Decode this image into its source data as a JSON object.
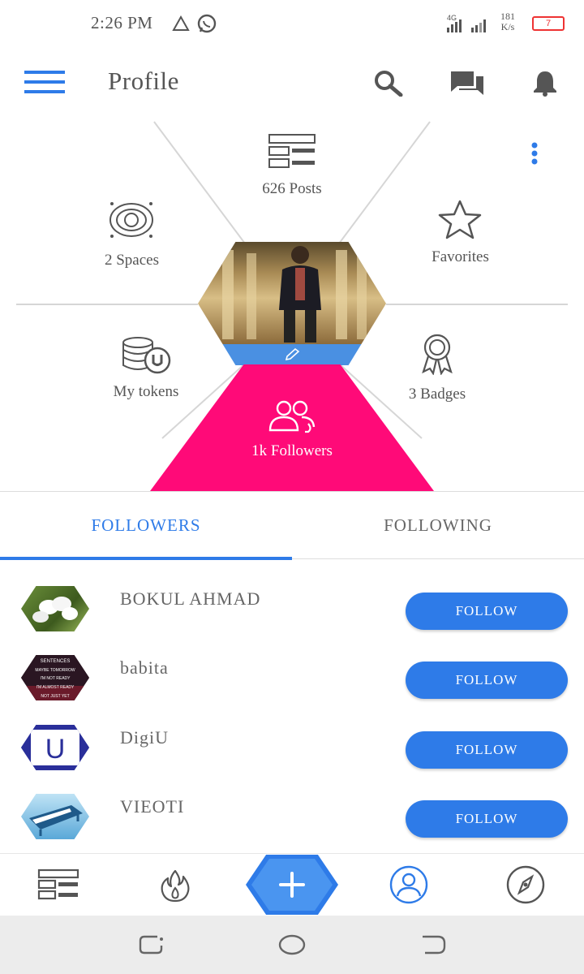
{
  "status_bar": {
    "time": "2:26 PM",
    "network": "4G",
    "data_rate_value": "181",
    "data_rate_unit": "K/s",
    "battery": "7"
  },
  "header": {
    "title": "Profile"
  },
  "profile_menu": {
    "posts_label": "626 Posts",
    "spaces_label": "2 Spaces",
    "favorites_label": "Favorites",
    "tokens_label": "My tokens",
    "badges_label": "3 Badges",
    "followers_label": "1k Followers"
  },
  "tabs": {
    "followers": "FOLLOWERS",
    "following": "FOLLOWING"
  },
  "followers_list": [
    {
      "name": "BOKUL AHMAD",
      "button": "FOLLOW"
    },
    {
      "name": "babita",
      "button": "FOLLOW",
      "avatar_text": [
        "SENTENCES",
        "MAYBE TOMORROW",
        "I'M NOT READY",
        "I'M ALMOST READY",
        "NOT JUST YET"
      ]
    },
    {
      "name": "DigiU",
      "button": "FOLLOW",
      "avatar_text": "U"
    },
    {
      "name": "VIEOTI",
      "button": "FOLLOW"
    }
  ],
  "colors": {
    "accent": "#2e7be8",
    "followers_highlight": "#ff0a78",
    "battery_low": "#e33333"
  },
  "icons": {
    "menu": "hamburger-icon",
    "search": "search-icon",
    "messages": "chat-icon",
    "notifications": "bell-icon",
    "more": "more-vertical-icon"
  }
}
